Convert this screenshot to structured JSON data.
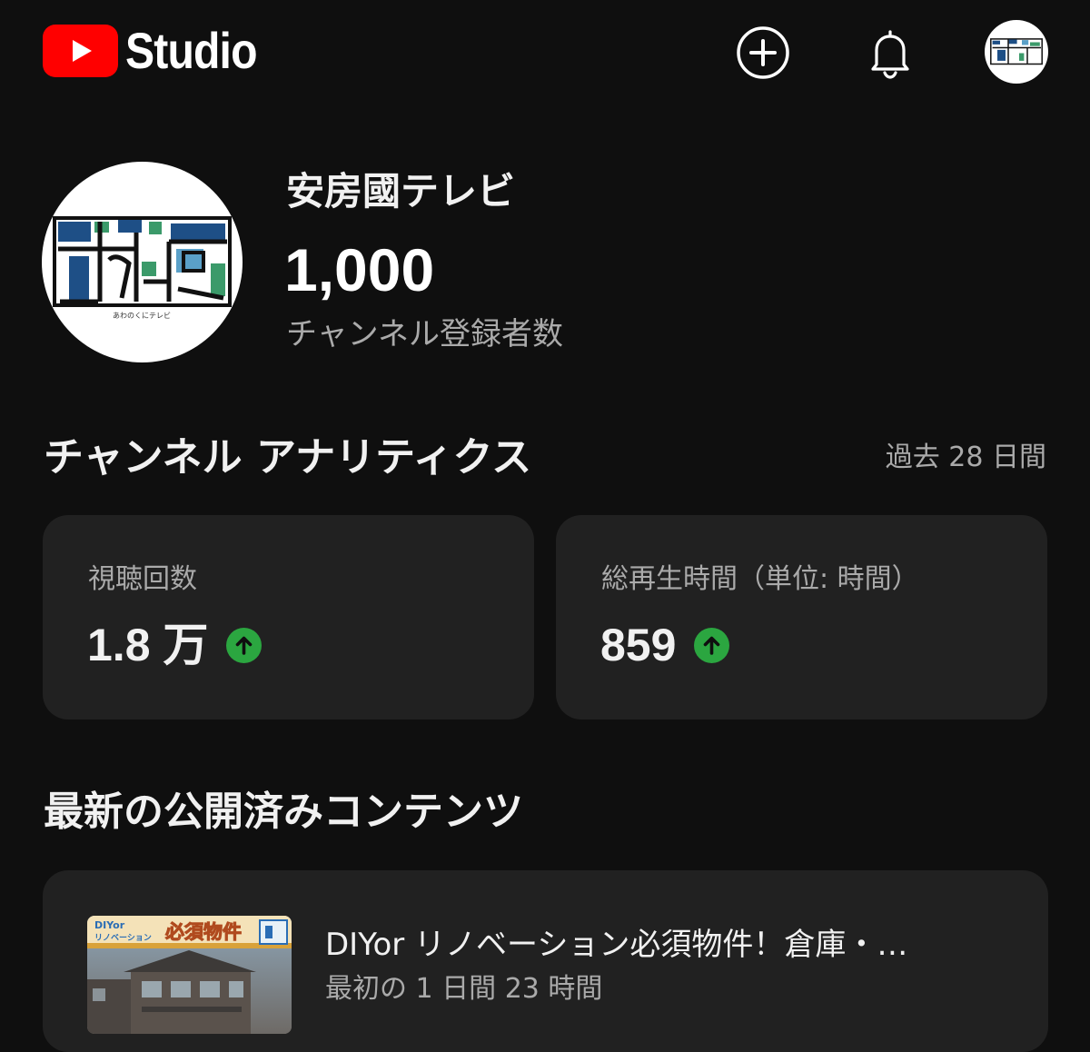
{
  "header": {
    "logo_text": "Studio",
    "create_icon": "plus-circle-icon",
    "notifications_icon": "bell-icon",
    "avatar_icon": "channel-avatar"
  },
  "channel": {
    "name": "安房國テレビ",
    "subscriber_count": "1,000",
    "subscriber_label": "チャンネル登録者数",
    "logo_caption": "あわのくにテレビ"
  },
  "analytics": {
    "title": "チャンネル アナリティクス",
    "period": "過去 28 日間",
    "cards": [
      {
        "label": "視聴回数",
        "value": "1.8 万",
        "trend": "up"
      },
      {
        "label": "総再生時間（単位: 時間）",
        "value": "859",
        "trend": "up"
      }
    ]
  },
  "latest": {
    "title": "最新の公開済みコンテンツ",
    "video": {
      "title": "DIYor リノベーション必須物件！倉庫・…",
      "subtitle": "最初の 1 日間 23 時間",
      "thumb_banner_small": "DIYor",
      "thumb_banner_small2": "リノベーション",
      "thumb_banner_big": "必須物件"
    }
  },
  "colors": {
    "background": "#0f0f0f",
    "card": "#212121",
    "brand_red": "#ff0000",
    "trend_up": "#2ba640",
    "secondary_text": "#aaaaaa"
  }
}
